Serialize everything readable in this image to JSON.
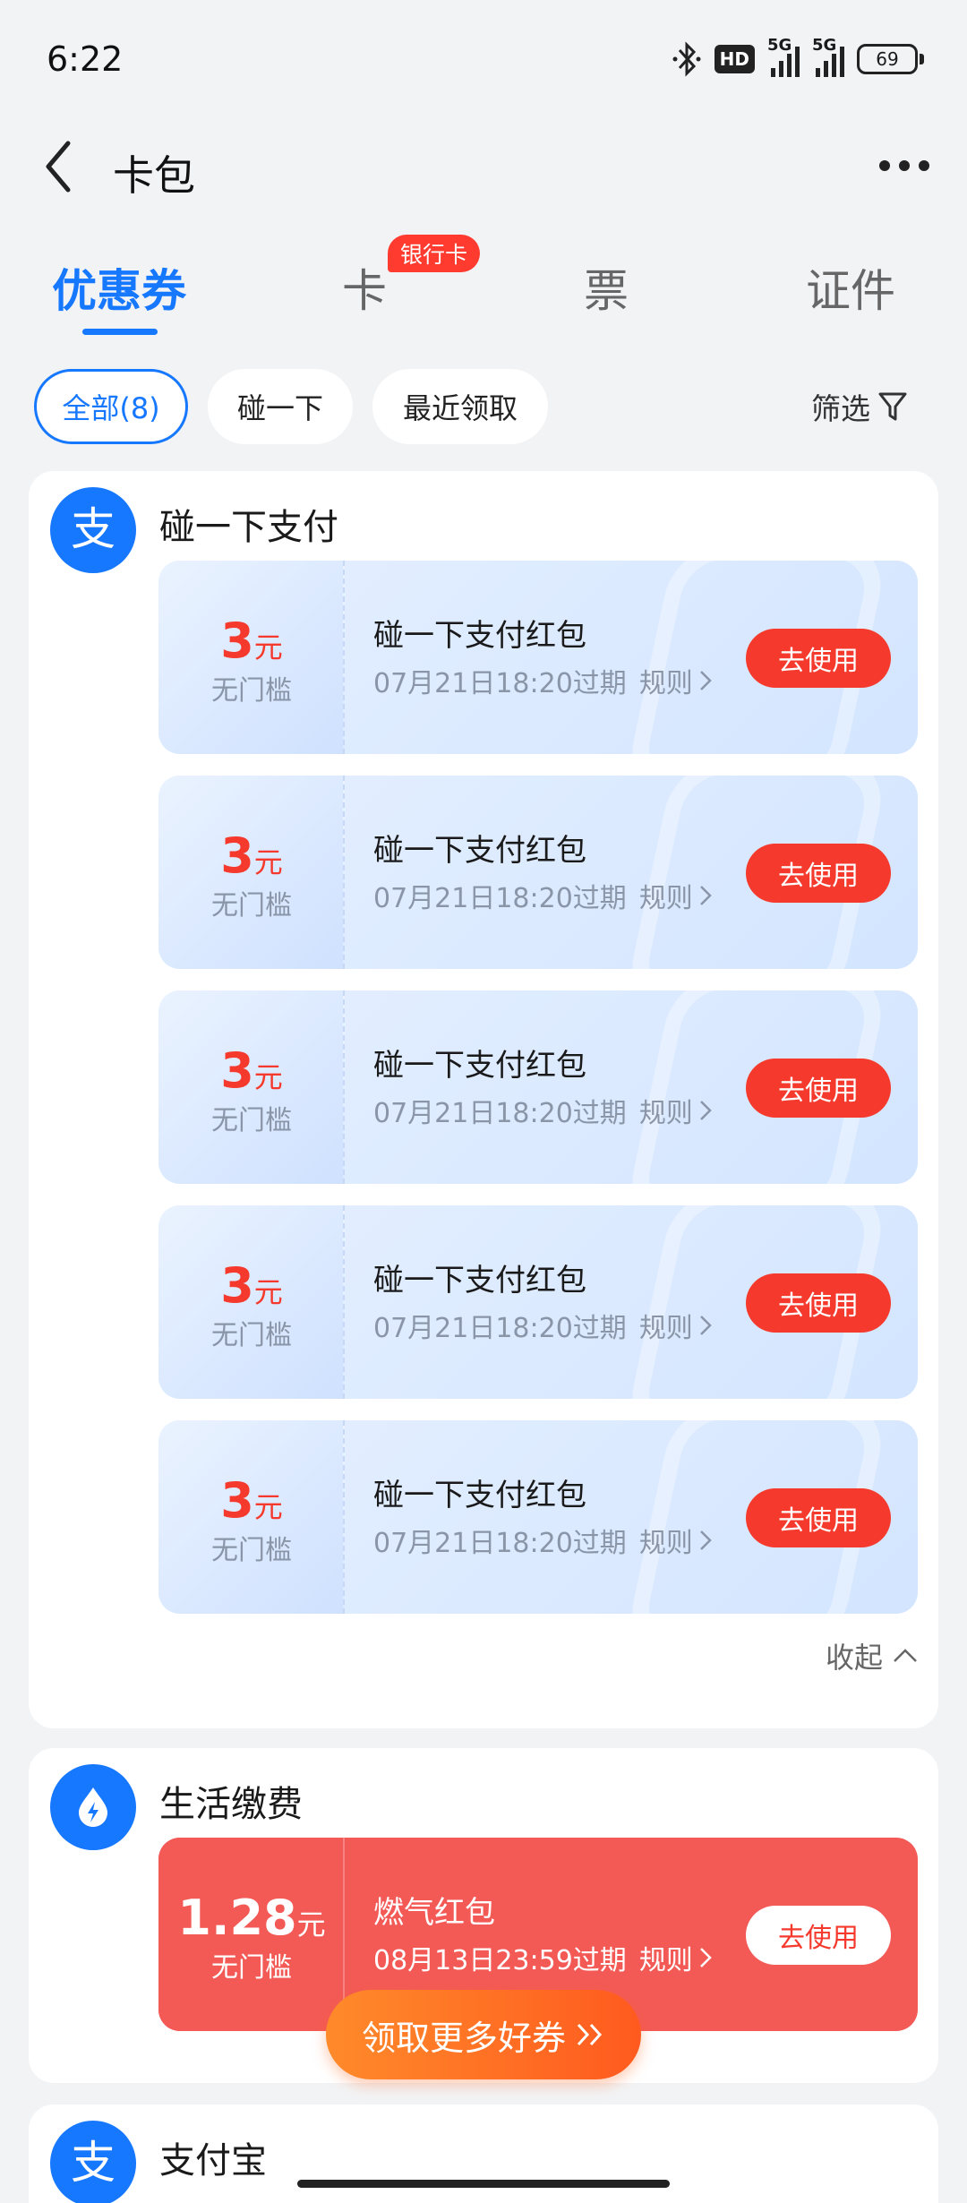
{
  "status_bar": {
    "time": "6:22",
    "hd_label": "HD",
    "signal1_label": "5G",
    "signal2_label": "5G",
    "battery": "69"
  },
  "header": {
    "title": "卡包"
  },
  "tabs": [
    {
      "label": "优惠券"
    },
    {
      "label": "卡"
    },
    {
      "label": "票"
    },
    {
      "label": "证件"
    }
  ],
  "tab_badge": "银行卡",
  "filters": {
    "chips": [
      {
        "label": "全部(8)"
      },
      {
        "label": "碰一下"
      },
      {
        "label": "最近领取"
      }
    ],
    "filter_label": "筛选"
  },
  "groups": [
    {
      "title": "碰一下支付",
      "logo_char": "支",
      "collapse_label": "收起",
      "coupons": [
        {
          "amount": "3",
          "unit": "元",
          "condition": "无门槛",
          "name": "碰一下支付红包",
          "expire": "07月21日18:20过期",
          "rule": "规则",
          "action": "去使用"
        },
        {
          "amount": "3",
          "unit": "元",
          "condition": "无门槛",
          "name": "碰一下支付红包",
          "expire": "07月21日18:20过期",
          "rule": "规则",
          "action": "去使用"
        },
        {
          "amount": "3",
          "unit": "元",
          "condition": "无门槛",
          "name": "碰一下支付红包",
          "expire": "07月21日18:20过期",
          "rule": "规则",
          "action": "去使用"
        },
        {
          "amount": "3",
          "unit": "元",
          "condition": "无门槛",
          "name": "碰一下支付红包",
          "expire": "07月21日18:20过期",
          "rule": "规则",
          "action": "去使用"
        },
        {
          "amount": "3",
          "unit": "元",
          "condition": "无门槛",
          "name": "碰一下支付红包",
          "expire": "07月21日18:20过期",
          "rule": "规则",
          "action": "去使用"
        }
      ]
    },
    {
      "title": "生活缴费",
      "coupons": [
        {
          "amount": "1.28",
          "unit": "元",
          "condition": "无门槛",
          "name": "燃气红包",
          "expire": "08月13日23:59过期",
          "rule": "规则",
          "action": "去使用"
        }
      ]
    },
    {
      "title": "支付宝",
      "logo_char": "支"
    }
  ],
  "cta_label": "领取更多好券",
  "colors": {
    "brand_blue": "#1677ff",
    "coupon_red": "#f53a2d",
    "cta_orange": "#ff6a1f"
  }
}
